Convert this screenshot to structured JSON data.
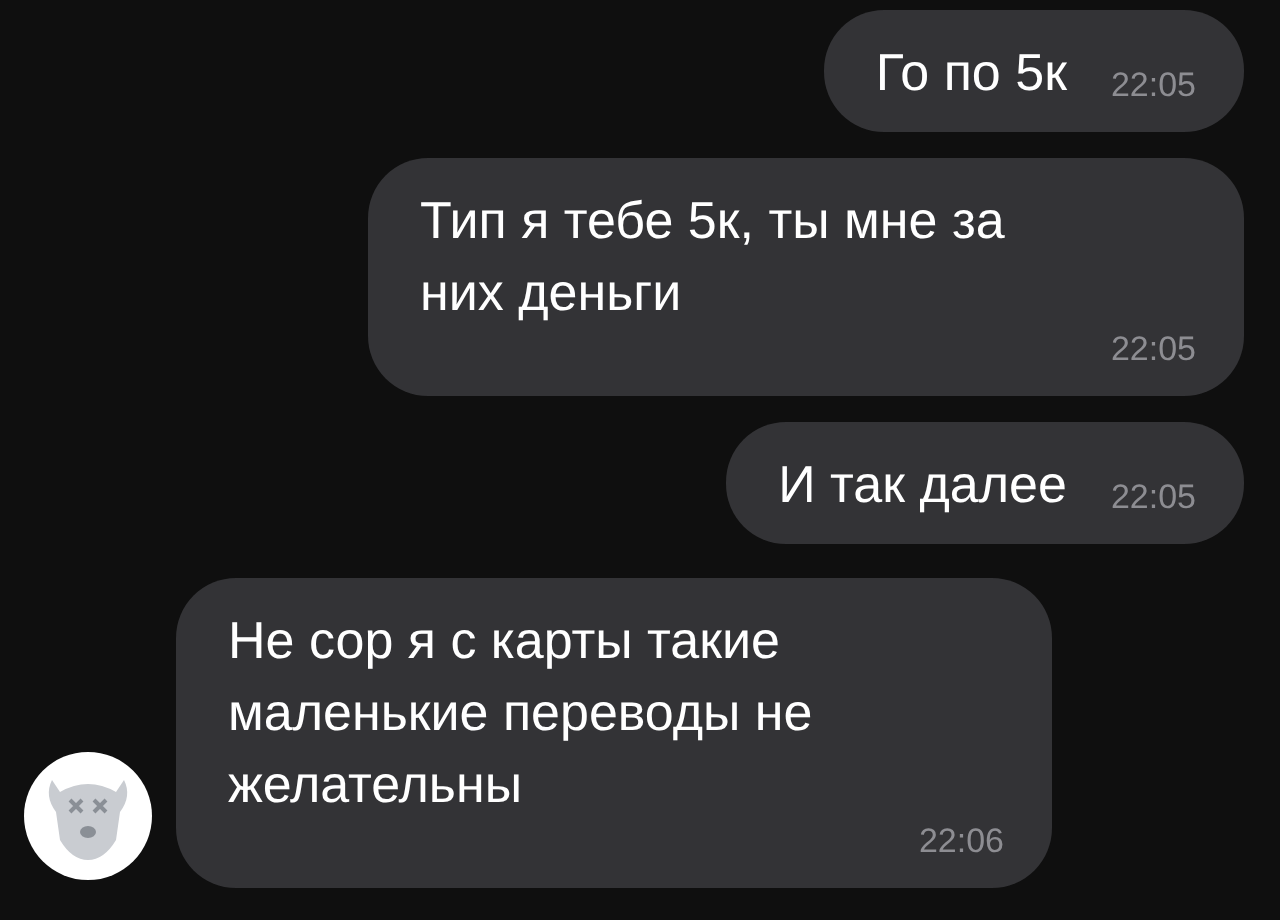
{
  "messages": [
    {
      "kind": "outgoing",
      "text": "Го по 5к",
      "time": "22:05"
    },
    {
      "kind": "outgoing",
      "text": "Тип я тебе 5к, ты мне за них деньги",
      "time": "22:05"
    },
    {
      "kind": "outgoing",
      "text": "И так далее",
      "time": "22:05"
    },
    {
      "kind": "incoming",
      "text": "Не сор я с карты такие маленькие переводы не желательны",
      "time": "22:06",
      "avatar": true
    }
  ]
}
